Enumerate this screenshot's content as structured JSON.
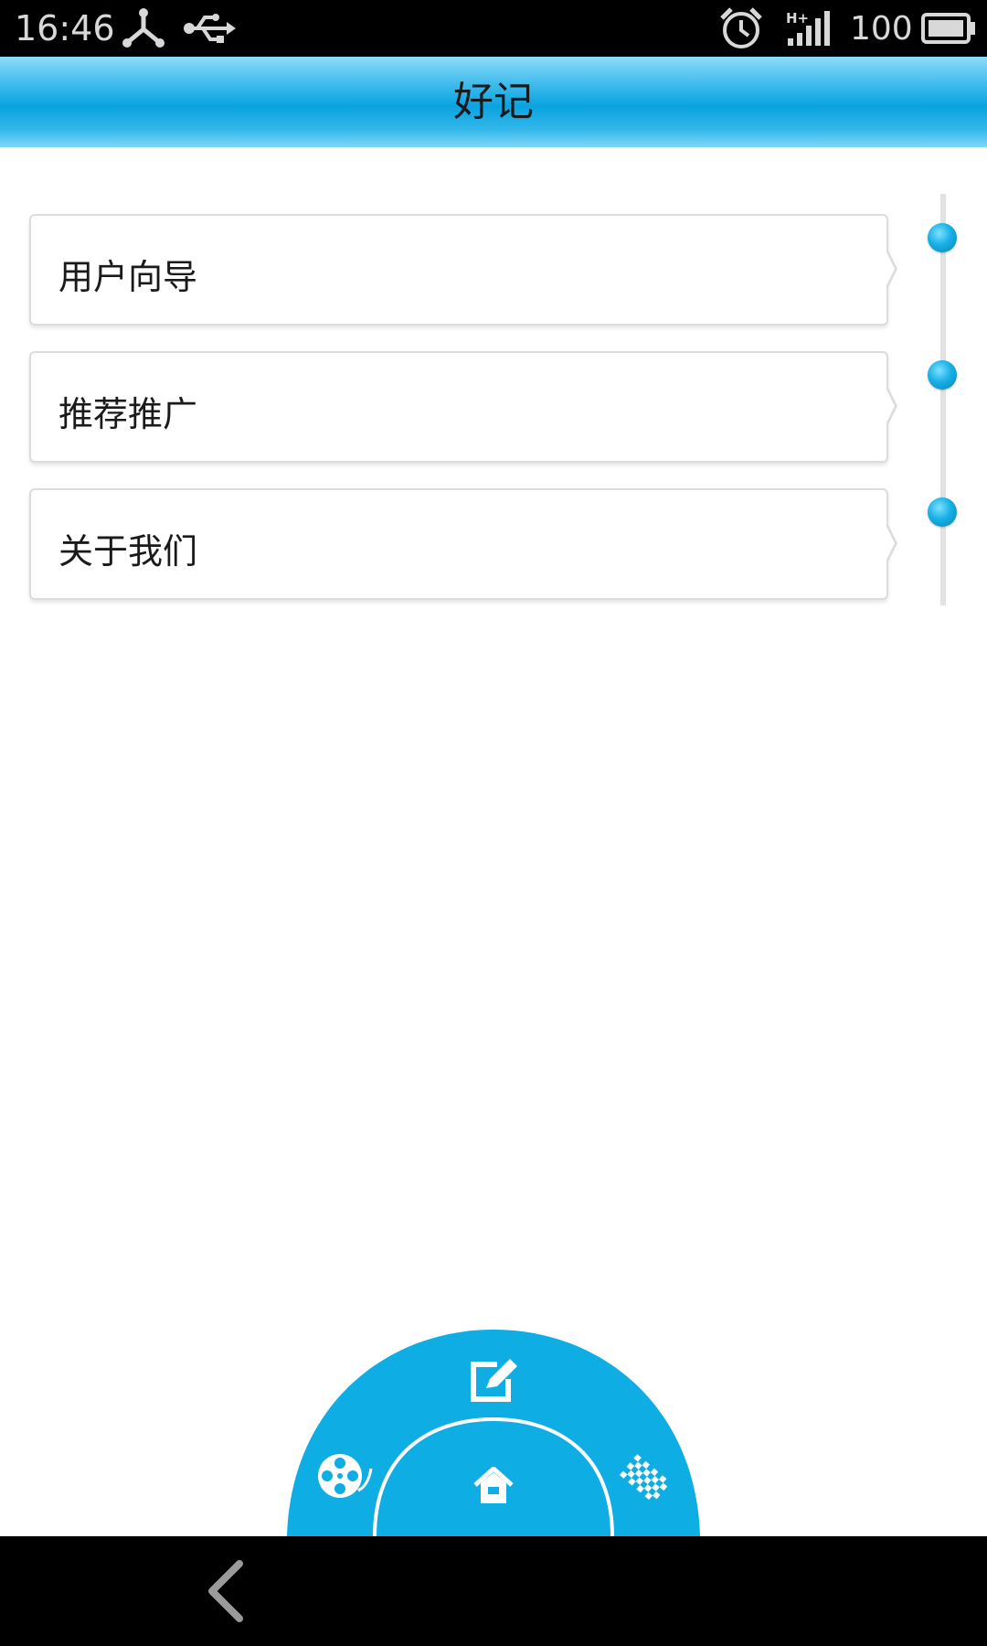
{
  "status_bar": {
    "time": "16:46",
    "battery_level": "100",
    "network": "H+",
    "icons": [
      "share-icon",
      "usb-icon",
      "alarm-icon",
      "signal-icon",
      "battery-icon"
    ]
  },
  "title_bar": {
    "title": "好记"
  },
  "menu": {
    "items": [
      {
        "label": "用户向导"
      },
      {
        "label": "推荐推广"
      },
      {
        "label": "关于我们"
      }
    ]
  },
  "radial_menu": {
    "accent_color": "#0eade4",
    "items": [
      "edit-icon",
      "film-reel-icon",
      "home-icon",
      "pattern-icon"
    ]
  },
  "nav_bar": {
    "items": [
      "back-arrow-icon"
    ]
  },
  "colors": {
    "accent": "#0aa3e0",
    "status_bar": "#000000",
    "background": "#ffffff"
  }
}
